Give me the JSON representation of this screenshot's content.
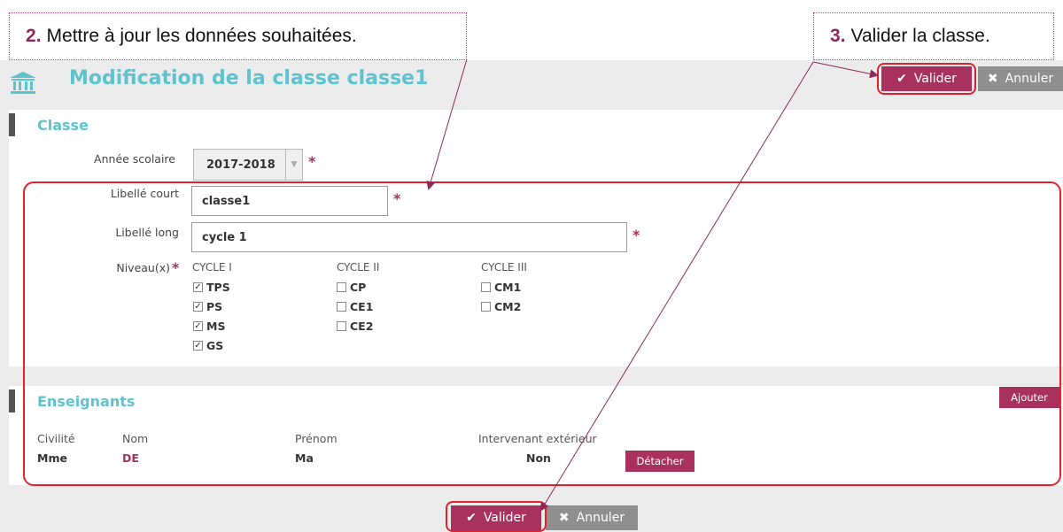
{
  "annotations": {
    "step2_number": "2.",
    "step2_text": "Mettre à jour les données souhaitées.",
    "step3_number": "3.",
    "step3_text": "Valider la classe."
  },
  "header": {
    "title": "Modification de la classe classe1",
    "validate_label": "Valider",
    "cancel_label": "Annuler"
  },
  "classe": {
    "section_title": "Classe",
    "annee_label": "Année scolaire",
    "annee_value": "2017-2018",
    "court_label": "Libellé court",
    "court_value": "classe1",
    "long_label": "Libellé long",
    "long_value": "cycle 1",
    "niveaux_label": "Niveau(x)",
    "required_mark": "*",
    "cycles": [
      {
        "title": "CYCLE I",
        "items": [
          {
            "label": "TPS",
            "checked": true
          },
          {
            "label": "PS",
            "checked": true
          },
          {
            "label": "MS",
            "checked": true
          },
          {
            "label": "GS",
            "checked": true
          }
        ]
      },
      {
        "title": "CYCLE II",
        "items": [
          {
            "label": "CP",
            "checked": false
          },
          {
            "label": "CE1",
            "checked": false
          },
          {
            "label": "CE2",
            "checked": false
          }
        ]
      },
      {
        "title": "CYCLE III",
        "items": [
          {
            "label": "CM1",
            "checked": false
          },
          {
            "label": "CM2",
            "checked": false
          }
        ]
      }
    ]
  },
  "enseignants": {
    "section_title": "Enseignants",
    "add_label": "Ajouter",
    "columns": [
      "Civilité",
      "Nom",
      "Prénom",
      "Intervenant extérieur"
    ],
    "row": {
      "civilite": "Mme",
      "nom": "DE",
      "prenom": "Ma",
      "intervenant": "Non"
    },
    "detach_label": "Détacher"
  },
  "footer": {
    "validate_label": "Valider",
    "cancel_label": "Annuler"
  },
  "colors": {
    "accent": "#a8315e",
    "title": "#5cc3cf",
    "highlight": "#e0222e"
  }
}
